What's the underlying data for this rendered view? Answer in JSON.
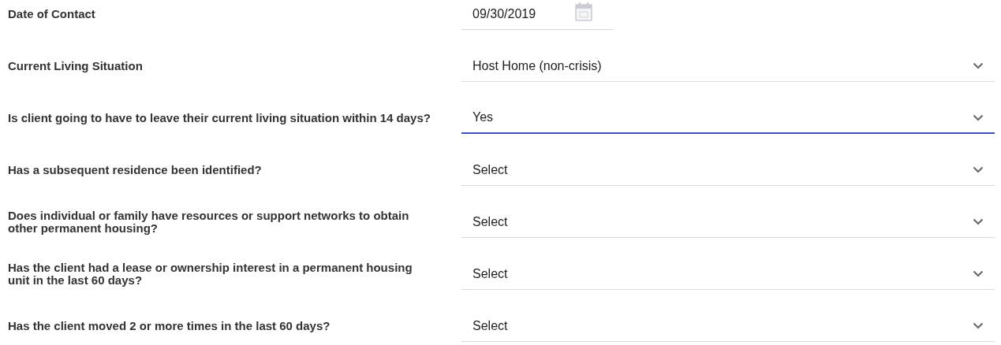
{
  "fields": [
    {
      "kind": "date",
      "label": "Date of Contact",
      "value": "09/30/2019",
      "focused": false
    },
    {
      "kind": "select",
      "label": "Current Living Situation",
      "value": "Host Home (non-crisis)",
      "focused": false
    },
    {
      "kind": "select",
      "label": "Is client going to have to leave their current living situation within 14 days?",
      "value": "Yes",
      "focused": true
    },
    {
      "kind": "select",
      "label": "Has a subsequent residence been identified?",
      "value": "Select",
      "focused": false
    },
    {
      "kind": "select",
      "label": "Does individual or family have resources or support networks to obtain other permanent housing?",
      "value": "Select",
      "focused": false
    },
    {
      "kind": "select",
      "label": "Has the client had a lease or ownership interest in a permanent housing unit in the last 60 days?",
      "value": "Select",
      "focused": false
    },
    {
      "kind": "select",
      "label": "Has the client moved 2 or more times in the last 60 days?",
      "value": "Select",
      "focused": false
    }
  ]
}
